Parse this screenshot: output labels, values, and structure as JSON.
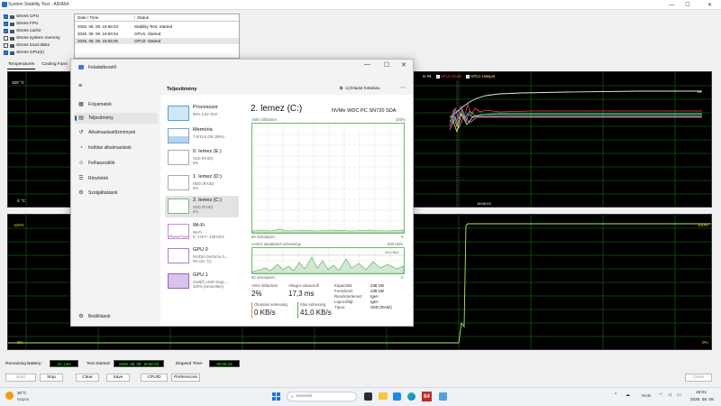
{
  "aida": {
    "title": "System Stability Test - AIDA64",
    "stress_options": [
      {
        "label": "Stress CPU",
        "checked": true
      },
      {
        "label": "Stress FPU",
        "checked": true
      },
      {
        "label": "Stress cache",
        "checked": true
      },
      {
        "label": "Stress system memory",
        "checked": false
      },
      {
        "label": "Stress local disks",
        "checked": false
      },
      {
        "label": "Stress GPU(s)",
        "checked": true
      }
    ],
    "log": {
      "headers": [
        "Date / Time",
        "Status"
      ],
      "rows": [
        {
          "date": "2026. 08. 09. 18:56:03",
          "status": "Stability Test: Started"
        },
        {
          "date": "2026. 08. 09. 18:56:04",
          "status": "GPU1: Started"
        },
        {
          "date": "2026. 08. 09. 18:56:05",
          "status": "GPU2: Started"
        }
      ]
    },
    "tabs": [
      "Temperatures",
      "Cooling Fans"
    ],
    "temp_graph": {
      "top_label": "100 °C",
      "bottom_label": "0 °C",
      "time_label": "18:56:03",
      "value_label": "64",
      "legend": [
        "GPU1 Diode",
        "GPU1 Hotspot"
      ],
      "legend_partial": "re #4"
    },
    "usage_graph": {
      "top_label": "100%",
      "bottom_label": "0%",
      "top_right": "100%",
      "bottom_right": "0%"
    },
    "status_bar": {
      "remaining_battery_label": "Remaining Battery:",
      "remaining_battery_value": "AC Line",
      "test_started_label": "Test Started:",
      "test_started_value": "2026. 08. 09. 18:56:03",
      "elapsed_label": "Elapsed Time:",
      "elapsed_value": "00:05:18"
    },
    "buttons": {
      "start": "Start",
      "stop": "Stop",
      "clear": "Clear",
      "save": "Save",
      "cpuid": "CPUID",
      "preferences": "Preferences",
      "close": "Close"
    }
  },
  "taskmgr": {
    "title": "Feladatkezelő",
    "nav": [
      {
        "label": "Folyamatok",
        "icon": "▦"
      },
      {
        "label": "Teljesítmény",
        "icon": "▤",
        "selected": true
      },
      {
        "label": "Alkalmazáselőzmények",
        "icon": "↺"
      },
      {
        "label": "Indítási alkalmazások",
        "icon": "◔"
      },
      {
        "label": "Felhasználók",
        "icon": "☺"
      },
      {
        "label": "Részletek",
        "icon": "☰"
      },
      {
        "label": "Szolgáltatások",
        "icon": "⚙"
      }
    ],
    "settings_label": "Beállítások",
    "header": "Teljesítmény",
    "run_task_label": "Új feladat futtatása",
    "devices": [
      {
        "name": "Processzor",
        "sub1": "95%  2,52 GHz",
        "sub2": ""
      },
      {
        "name": "Memória",
        "sub1": "7,6/15,8 GB (48%)",
        "sub2": ""
      },
      {
        "name": "0. lemez (E:)",
        "sub1": "SSD (RAID)",
        "sub2": "5%"
      },
      {
        "name": "1. lemez (D:)",
        "sub1": "HDD (RAID)",
        "sub2": "0%"
      },
      {
        "name": "2. lemez (C:)",
        "sub1": "SSD (RAID)",
        "sub2": "2%"
      },
      {
        "name": "Wi-Fi",
        "sub1": "Wi-Fi",
        "sub2": "K: 176  F: 128 Kb/s"
      },
      {
        "name": "GPU 0",
        "sub1": "NVIDIA GeForce G...",
        "sub2": "0% (61 °C)"
      },
      {
        "name": "GPU 1",
        "sub1": "Intel(R) UHD Grap...",
        "sub2": "100% (ismeretlen)"
      }
    ],
    "detail": {
      "title": "2. lemez (C:)",
      "model": "NVMe WDC PC SN720 SDA",
      "active_time_label": "Aktív időtartam",
      "pct100": "100%",
      "seconds_label": "60 másodperc",
      "zero": "0",
      "transfer_label": "Lemez adatátviteli sebessége",
      "transfer_max": "500 KB/s",
      "transfer_mid": "400 KB/s",
      "stats": {
        "active_label": "Aktív időtartam",
        "active_value": "2%",
        "resp_label": "Átlagos válaszidő",
        "resp_value": "17,3 ms",
        "read_label": "Olvasási sebesség",
        "read_value": "0 KB/s",
        "write_label": "Írási sebesség",
        "write_value": "41,0 KB/s"
      },
      "props": [
        {
          "k": "Kapacitás:",
          "v": "238 GB"
        },
        {
          "k": "Formázott:",
          "v": "239 GB"
        },
        {
          "k": "Rendszerlemez:",
          "v": "Igen"
        },
        {
          "k": "Lapozófájl:",
          "v": "Igen"
        },
        {
          "k": "Típus:",
          "v": "SSD (RAID)"
        }
      ]
    }
  },
  "taskbar": {
    "weather_temp": "30°C",
    "weather_desc": "Napos",
    "search_placeholder": "Keresés",
    "lang": "HUN",
    "time": "19:01",
    "date": "2026. 08. 09."
  }
}
